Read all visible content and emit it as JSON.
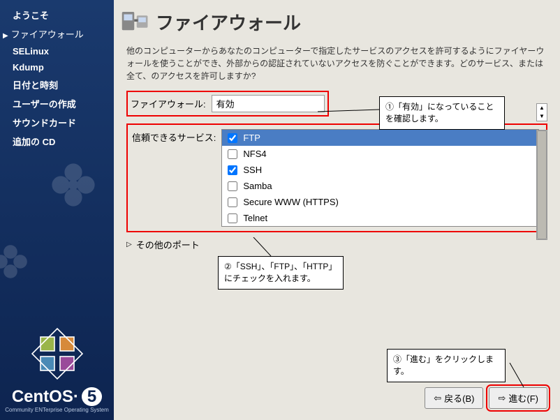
{
  "sidebar": {
    "items": [
      {
        "label": "ようこそ"
      },
      {
        "label": "ファイアウォール"
      },
      {
        "label": "SELinux"
      },
      {
        "label": "Kdump"
      },
      {
        "label": "日付と時刻"
      },
      {
        "label": "ユーザーの作成"
      },
      {
        "label": "サウンドカード"
      },
      {
        "label": "追加の CD"
      }
    ]
  },
  "logo": {
    "text": "CentOS",
    "num": "5",
    "sub": "Community ENTerprise Operating System"
  },
  "header": {
    "title": "ファイアウォール"
  },
  "description": "他のコンピューターからあなたのコンピューターで指定したサービスのアクセスを許可するようにファイヤーウォールを使うことができ、外部からの認証されていないアクセスを防ぐことができます。どのサービス、または全て、のアクセスを許可しますか?",
  "firewall": {
    "label": "ファイアウォール:",
    "value": "有効"
  },
  "services": {
    "label": "信頼できるサービス:",
    "items": [
      {
        "name": "FTP",
        "checked": true,
        "selected": true
      },
      {
        "name": "NFS4",
        "checked": false,
        "selected": false
      },
      {
        "name": "SSH",
        "checked": true,
        "selected": false
      },
      {
        "name": "Samba",
        "checked": false,
        "selected": false
      },
      {
        "name": "Secure WWW (HTTPS)",
        "checked": false,
        "selected": false
      },
      {
        "name": "Telnet",
        "checked": false,
        "selected": false
      }
    ]
  },
  "other_ports": "その他のポート",
  "callouts": {
    "c1": "①「有効」になっていることを確認します。",
    "c2": "②「SSH」、「FTP」、「HTTP」にチェックを入れます。",
    "c3": "③「進む」をクリックします。"
  },
  "buttons": {
    "back": "戻る(B)",
    "next": "進む(F)"
  }
}
